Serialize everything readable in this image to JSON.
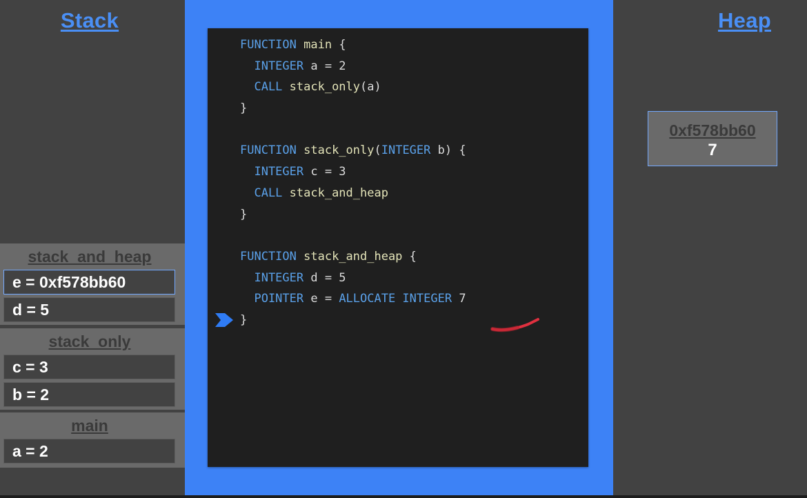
{
  "stack": {
    "title": "Stack",
    "frames": [
      {
        "name": "stack_and_heap",
        "vars": [
          "e = 0xf578bb60",
          "d = 5"
        ]
      },
      {
        "name": "stack_only",
        "vars": [
          "c = 3",
          "b = 2"
        ]
      },
      {
        "name": "main",
        "vars": [
          "a = 2"
        ]
      }
    ]
  },
  "heap": {
    "title": "Heap",
    "blocks": [
      {
        "address": "0xf578bb60",
        "value": "7"
      }
    ]
  },
  "code": {
    "lines": [
      [
        {
          "t": "kw",
          "v": "FUNCTION "
        },
        {
          "t": "fn",
          "v": "main"
        },
        {
          "t": "plain",
          "v": " {"
        }
      ],
      [
        {
          "t": "kw",
          "v": "  INTEGER "
        },
        {
          "t": "plain",
          "v": "a = 2"
        }
      ],
      [
        {
          "t": "kw",
          "v": "  CALL "
        },
        {
          "t": "fn",
          "v": "stack_only"
        },
        {
          "t": "plain",
          "v": "(a)"
        }
      ],
      [
        {
          "t": "plain",
          "v": "}"
        }
      ],
      [],
      [
        {
          "t": "kw",
          "v": "FUNCTION "
        },
        {
          "t": "fn",
          "v": "stack_only"
        },
        {
          "t": "plain",
          "v": "("
        },
        {
          "t": "kw",
          "v": "INTEGER"
        },
        {
          "t": "plain",
          "v": " b) {"
        }
      ],
      [
        {
          "t": "kw",
          "v": "  INTEGER "
        },
        {
          "t": "plain",
          "v": "c = 3"
        }
      ],
      [
        {
          "t": "kw",
          "v": "  CALL "
        },
        {
          "t": "fn",
          "v": "stack_and_heap"
        }
      ],
      [
        {
          "t": "plain",
          "v": "}"
        }
      ],
      [],
      [
        {
          "t": "kw",
          "v": "FUNCTION "
        },
        {
          "t": "fn",
          "v": "stack_and_heap"
        },
        {
          "t": "plain",
          "v": " {"
        }
      ],
      [
        {
          "t": "kw",
          "v": "  INTEGER "
        },
        {
          "t": "plain",
          "v": "d = 5"
        }
      ],
      [
        {
          "t": "kw",
          "v": "  POINTER "
        },
        {
          "t": "plain",
          "v": "e = "
        },
        {
          "t": "kw",
          "v": "ALLOCATE INTEGER"
        },
        {
          "t": "plain",
          "v": " 7"
        }
      ],
      [
        {
          "t": "plain",
          "v": "}"
        }
      ]
    ],
    "current_line": 14
  },
  "colors": {
    "accent_blue": "#3d82f6",
    "title_blue": "#4a8ff5",
    "keyword": "#5aa0e8",
    "function_name": "#e3e3b8",
    "active_border": "#74a9ff",
    "pen_mark": "#e0303f"
  },
  "icons": {
    "exec_pointer": "chevron-right-icon"
  }
}
